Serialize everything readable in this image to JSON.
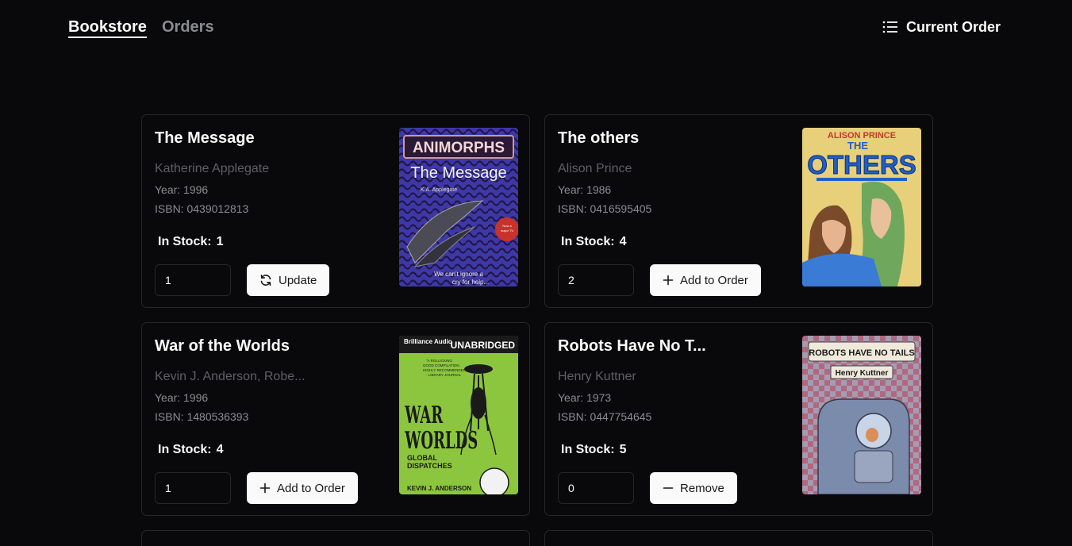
{
  "nav": {
    "bookstore_label": "Bookstore",
    "orders_label": "Orders",
    "current_order_label": "Current Order"
  },
  "books": [
    {
      "title": "The Message",
      "author": "Katherine Applegate",
      "year": "Year: 1996",
      "isbn": "ISBN: 0439012813",
      "stock_label": "In Stock:",
      "stock": "1",
      "quantity": "1",
      "action_label": "Update",
      "action_icon": "refresh-icon",
      "cover": {
        "brand": "ANIMORPHS",
        "title": "The Message",
        "author": "K.A. Applegate",
        "blurb": "Now a major TV series on NBC and Nickelodeon",
        "tagline": "We can't ignore a cry for help...",
        "colors": [
          "#3b3fb0",
          "#2a58c8",
          "#6a2aa0"
        ]
      }
    },
    {
      "title": "The others",
      "author": "Alison Prince",
      "year": "Year: 1986",
      "isbn": "ISBN: 0416595405",
      "stock_label": "In Stock:",
      "stock": "4",
      "quantity": "2",
      "action_label": "Add to Order",
      "action_icon": "plus-icon",
      "cover": {
        "author": "ALISON PRINCE",
        "title1": "THE",
        "title2": "OTHERS",
        "colors": [
          "#e9c46a",
          "#2a6fd6",
          "#6aa85a"
        ]
      }
    },
    {
      "title": "War of the Worlds",
      "author": "Kevin J. Anderson, Robe...",
      "year": "Year: 1996",
      "isbn": "ISBN: 1480536393",
      "stock_label": "In Stock:",
      "stock": "4",
      "quantity": "1",
      "action_label": "Add to Order",
      "action_icon": "plus-icon",
      "cover": {
        "publisher": "Brilliance Audio",
        "edition": "UNABRIDGED",
        "quote": "A ROLLICKING GOOD COMPILATION. HIGHLY RECOMMENDED. - LIBRARY JOURNAL",
        "title": "WAR OF THE WORLDS",
        "subtitle": "GLOBAL DISPATCHES",
        "editor": "KEVIN J. ANDERSON",
        "colors": [
          "#8cc63f",
          "#111111"
        ]
      }
    },
    {
      "title": "Robots Have No T...",
      "author": "Henry Kuttner",
      "year": "Year: 1973",
      "isbn": "ISBN: 0447754645",
      "stock_label": "In Stock:",
      "stock": "5",
      "quantity": "0",
      "action_label": "Remove",
      "action_icon": "minus-icon",
      "cover": {
        "title": "ROBOTS HAVE NO TAILS",
        "author": "Henry Kuttner",
        "colors": [
          "#b7a9b5",
          "#c24b5a",
          "#7a8aa8"
        ]
      }
    }
  ]
}
